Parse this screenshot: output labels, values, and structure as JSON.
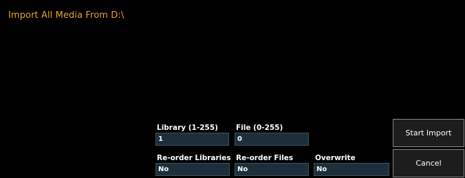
{
  "dialog": {
    "title": "Import All Media From D:\\"
  },
  "fields": {
    "library": {
      "label": "Library (1-255)",
      "value": "1"
    },
    "file": {
      "label": "File (0-255)",
      "value": "0"
    },
    "reorder_libraries": {
      "label": "Re-order Libraries",
      "value": "No"
    },
    "reorder_files": {
      "label": "Re-order Files",
      "value": "No"
    },
    "overwrite": {
      "label": "Overwrite",
      "value": "No"
    }
  },
  "buttons": {
    "start_import": "Start Import",
    "cancel": "Cancel"
  },
  "colors": {
    "title": "#e6a23c",
    "field_bg": "#1d2f3a",
    "field_border": "#3c5362",
    "button_border": "#8a8a8a"
  }
}
